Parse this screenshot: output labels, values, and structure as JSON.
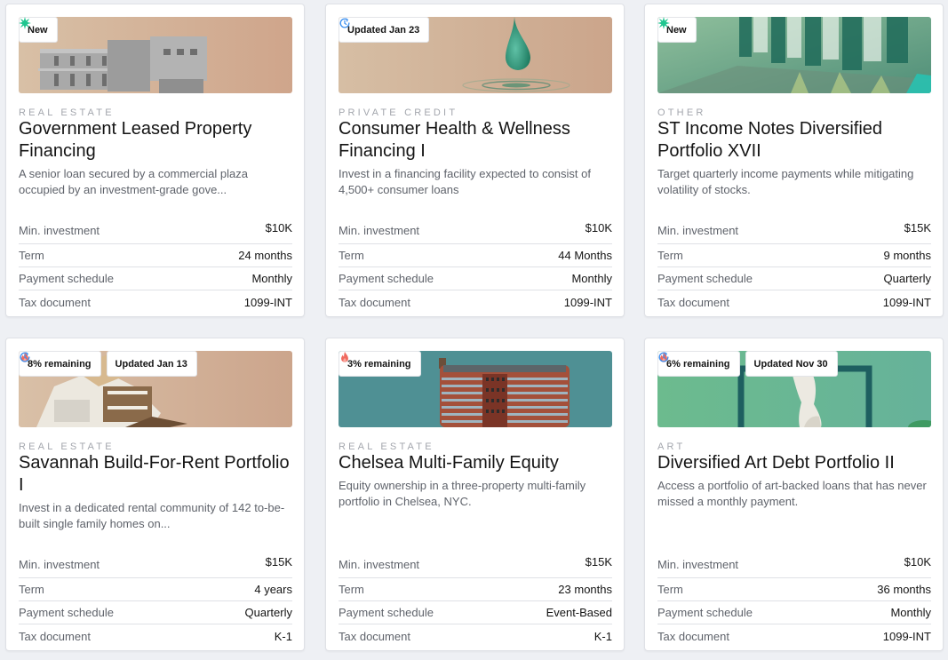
{
  "labels": {
    "min_investment": "Min. investment",
    "term": "Term",
    "payment_schedule": "Payment schedule",
    "tax_document": "Tax document"
  },
  "colors": {
    "new_icon": "#1fc68f",
    "updated_icon": "#3b8ff0",
    "fire_icon": "#f06a5f"
  },
  "cards": [
    {
      "badges": [
        {
          "icon": "sparkle-icon",
          "label": "New"
        }
      ],
      "image": "commercial-plaza-building",
      "category": "REAL ESTATE",
      "title": "Government Leased Property Financing",
      "description": "A senior loan secured by a commercial plaza occupied by an investment-grade gove...",
      "min_investment": "$10K",
      "term": "24 months",
      "payment_schedule": "Monthly",
      "tax_document": "1099-INT"
    },
    {
      "badges": [
        {
          "icon": "refresh-clock-icon",
          "label": "Updated Jan 23"
        }
      ],
      "image": "water-drop",
      "category": "PRIVATE CREDIT",
      "title": "Consumer Health & Wellness Financing I",
      "description": "Invest in a financing facility expected to consist of 4,500+ consumer loans",
      "min_investment": "$10K",
      "term": "44 Months",
      "payment_schedule": "Monthly",
      "tax_document": "1099-INT"
    },
    {
      "badges": [
        {
          "icon": "sparkle-icon",
          "label": "New"
        }
      ],
      "image": "glass-blocks",
      "category": "OTHER",
      "title": "ST Income Notes Diversified Portfolio XVII",
      "description": "Target quarterly income payments while mitigating volatility of stocks.",
      "min_investment": "$15K",
      "term": "9 months",
      "payment_schedule": "Quarterly",
      "tax_document": "1099-INT"
    },
    {
      "badges": [
        {
          "icon": "fire-icon",
          "label": "8% remaining"
        },
        {
          "icon": "refresh-clock-icon",
          "label": "Updated Jan 13"
        }
      ],
      "image": "house-cutaway",
      "category": "REAL ESTATE",
      "title": "Savannah Build-For-Rent Portfolio I",
      "description": "Invest in a dedicated rental community of 142 to-be-built single family homes on...",
      "min_investment": "$15K",
      "term": "4 years",
      "payment_schedule": "Quarterly",
      "tax_document": "K-1"
    },
    {
      "badges": [
        {
          "icon": "fire-icon",
          "label": "3% remaining"
        }
      ],
      "image": "brick-tower",
      "category": "REAL ESTATE",
      "title": "Chelsea Multi-Family Equity",
      "description": "Equity ownership in a three-property multi-family portfolio in Chelsea, NYC.",
      "min_investment": "$15K",
      "term": "23 months",
      "payment_schedule": "Event-Based",
      "tax_document": "K-1"
    },
    {
      "badges": [
        {
          "icon": "fire-icon",
          "label": "6% remaining"
        },
        {
          "icon": "refresh-clock-icon",
          "label": "Updated Nov 30"
        }
      ],
      "image": "venus-statue",
      "category": "ART",
      "title": "Diversified Art Debt Portfolio II",
      "description": "Access a portfolio of art-backed loans that has never missed a monthly payment.",
      "min_investment": "$10K",
      "term": "36 months",
      "payment_schedule": "Monthly",
      "tax_document": "1099-INT"
    }
  ]
}
